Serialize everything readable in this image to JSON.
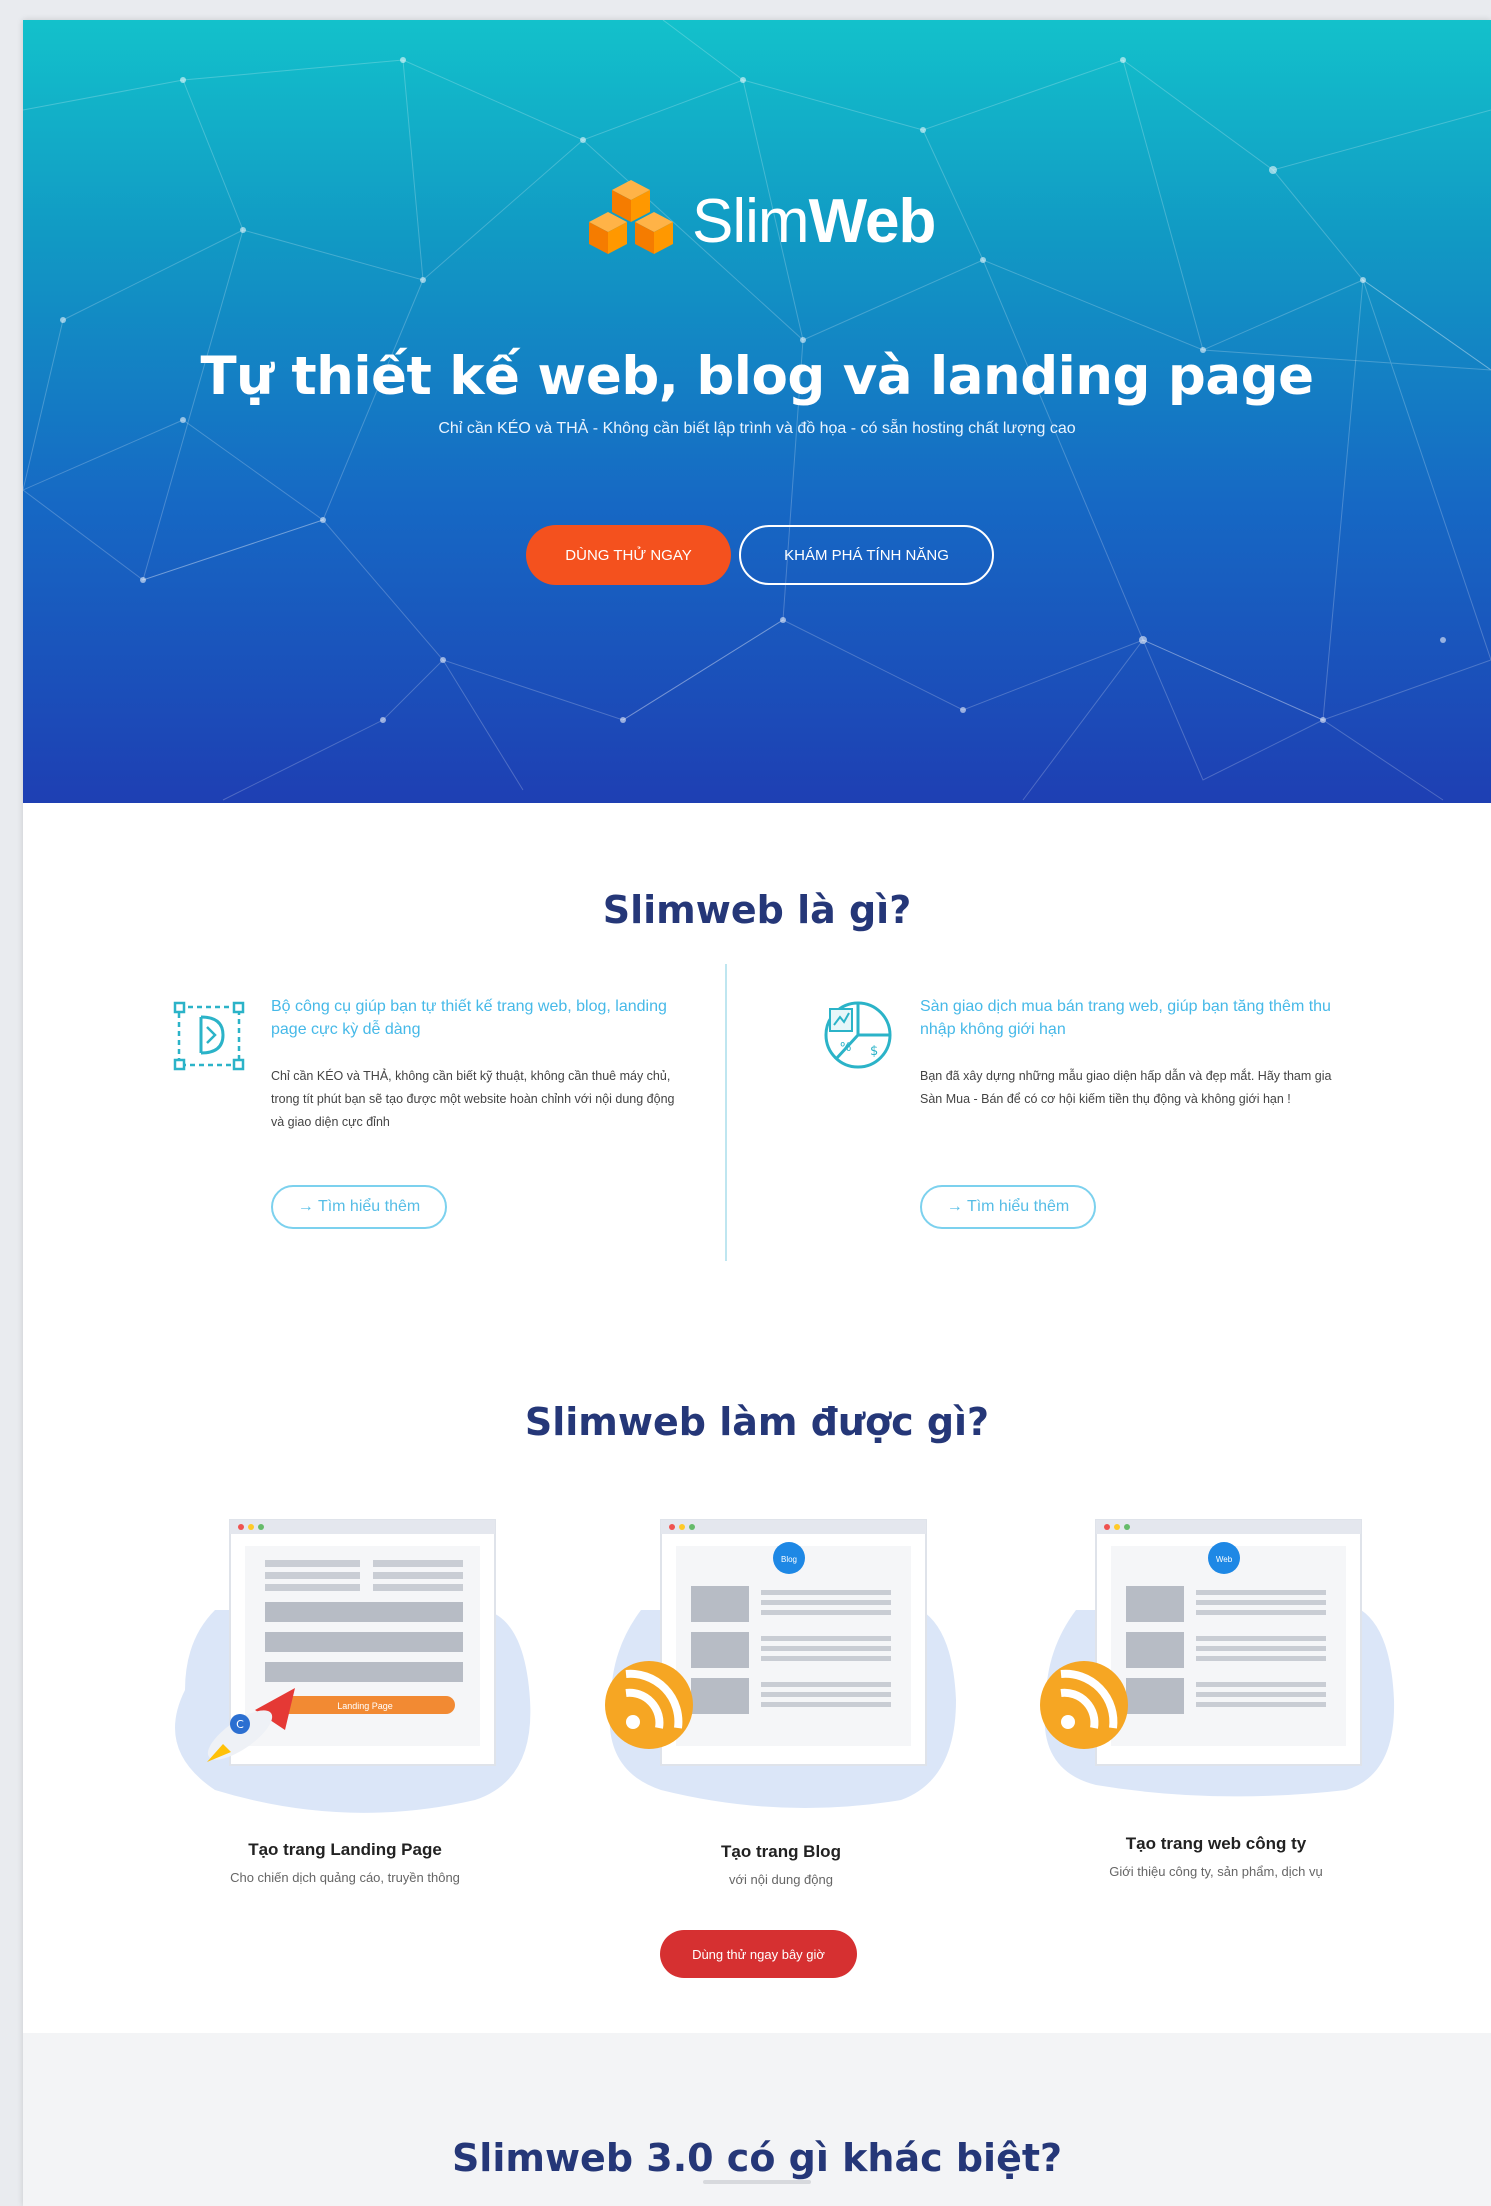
{
  "hero": {
    "logo_text_light": "Slim",
    "logo_text_bold": "Web",
    "title": "Tự thiết kế web, blog và landing page",
    "subtitle": "Chỉ cần KÉO và THẢ - Không cần biết lập trình và đồ họa - có sẵn hosting chất lượng cao",
    "btn_try": "DÙNG THỬ NGAY",
    "btn_explore": "KHÁM PHÁ TÍNH NĂNG",
    "gradient_colors": [
      "#13c1cb",
      "#1199c4",
      "#1668c4",
      "#1e3fb3"
    ]
  },
  "about": {
    "title": "Slimweb là gì?",
    "features": [
      {
        "title": "Bộ công cụ giúp bạn tự thiết kế trang web, blog, landing page cực kỳ dễ dàng",
        "desc": "Chỉ cần KÉO và THẢ, không cần biết kỹ thuật, không cần thuê máy chủ, trong tít phút bạn sẽ tạo được một website hoàn chỉnh với nội dung động và giao diện cực đỉnh",
        "button": "→ Tìm hiểu thêm",
        "icon": "drag-drop-design-icon"
      },
      {
        "title": "Sàn giao dịch mua bán trang web, giúp bạn tăng thêm thu nhập không giới hạn",
        "desc": "Bạn đã xây dựng những mẫu giao diện hấp dẫn và đẹp mắt. Hãy tham gia Sàn Mua - Bán để có cơ hội kiếm tiền thụ động và không giới hạn !",
        "button": "→ Tìm hiểu thêm",
        "icon": "marketplace-chart-icon"
      }
    ]
  },
  "capabilities": {
    "title": "Slimweb làm được gì?",
    "cards": [
      {
        "title": "Tạo trang Landing Page",
        "sub": "Cho chiến dịch quảng cáo, truyền thông",
        "badge": "Landing Page"
      },
      {
        "title": "Tạo trang Blog",
        "sub": "với nội dung động",
        "badge": ""
      },
      {
        "title": "Tạo trang web công ty",
        "sub": "Giới thiệu công ty, sản phẩm, dịch vụ",
        "badge": ""
      }
    ],
    "cta": "Dùng thử ngay bây giờ"
  },
  "difference": {
    "title": "Slimweb 3.0 có gì khác biệt?"
  }
}
